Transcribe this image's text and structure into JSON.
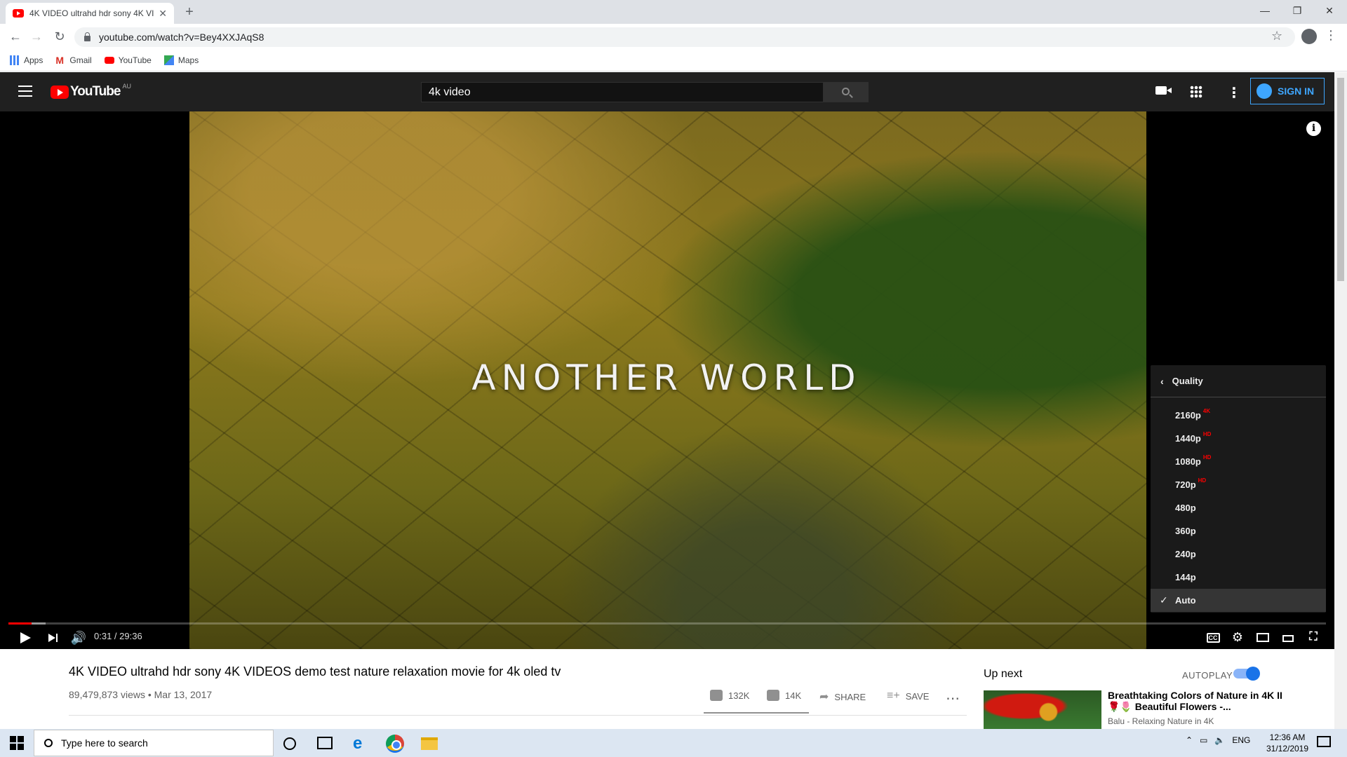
{
  "browser": {
    "tab_title": "4K VIDEO ultrahd hdr sony 4K VI",
    "url": "youtube.com/watch?v=Bey4XXJAqS8",
    "bookmarks": [
      "Apps",
      "Gmail",
      "YouTube",
      "Maps"
    ]
  },
  "youtube": {
    "logo_text": "YouTube",
    "country_code": "AU",
    "search_value": "4k video",
    "sign_in": "SIGN IN"
  },
  "player": {
    "overlay_title": "ANOTHER WORLD",
    "time": "0:31 / 29:36",
    "progress_fraction": 0.0175,
    "buffer_fraction": 0.028,
    "quality_menu": {
      "title": "Quality",
      "options": [
        {
          "label": "2160p",
          "badge": "4K"
        },
        {
          "label": "1440p",
          "badge": "HD"
        },
        {
          "label": "1080p",
          "badge": "HD"
        },
        {
          "label": "720p",
          "badge": "HD"
        },
        {
          "label": "480p",
          "badge": ""
        },
        {
          "label": "360p",
          "badge": ""
        },
        {
          "label": "240p",
          "badge": ""
        },
        {
          "label": "144p",
          "badge": ""
        },
        {
          "label": "Auto",
          "badge": ""
        }
      ],
      "selected": "Auto"
    }
  },
  "video": {
    "title": "4K VIDEO ultrahd hdr sony 4K VIDEOS demo test nature relaxation movie for 4k oled tv",
    "meta": "89,479,873 views • Mar 13, 2017",
    "likes": "132K",
    "dislikes": "14K",
    "share": "SHARE",
    "save": "SAVE"
  },
  "sidebar": {
    "up_next": "Up next",
    "autoplay": "AUTOPLAY",
    "autoplay_on": true,
    "related": {
      "title": "Breathtaking Colors of Nature in 4K II 🌹🌷 Beautiful Flowers -...",
      "channel": "Balu - Relaxing Nature in 4K"
    }
  },
  "taskbar": {
    "search_placeholder": "Type here to search",
    "lang": "ENG",
    "time": "12:36 AM",
    "date": "31/12/2019"
  },
  "colors": {
    "youtube_red": "#ff0000",
    "masthead": "#202020",
    "accent_blue": "#3ea6ff"
  }
}
